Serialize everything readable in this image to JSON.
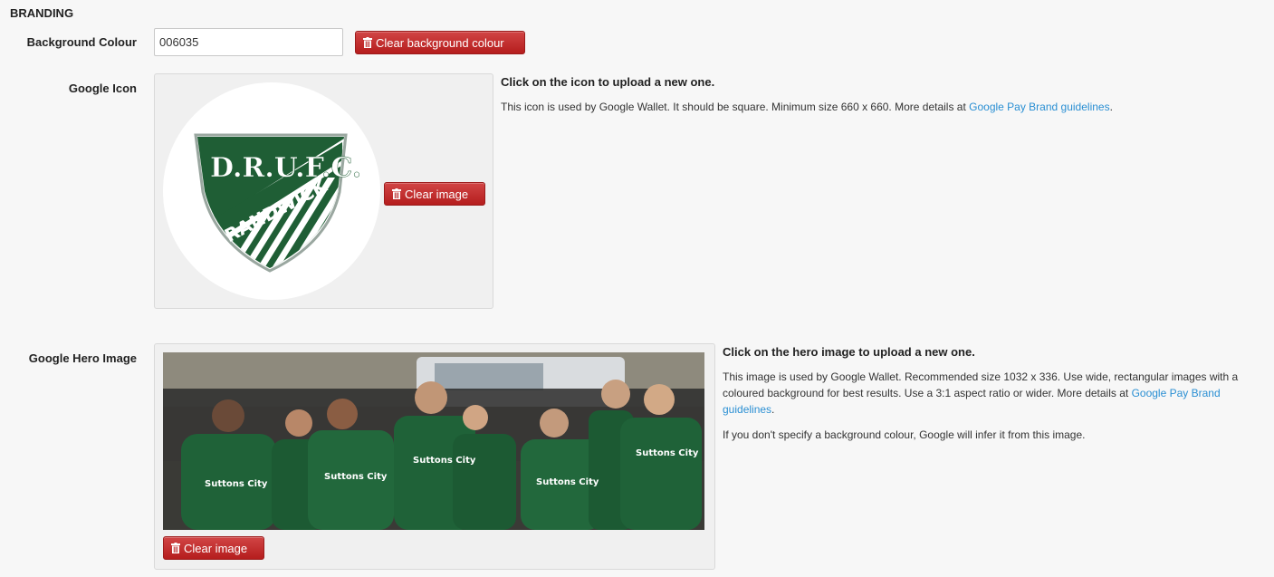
{
  "section": {
    "title": "BRANDING"
  },
  "background_colour": {
    "label": "Background Colour",
    "value": "006035",
    "clear_label": "Clear background colour"
  },
  "google_icon": {
    "label": "Google Icon",
    "help_title": "Click on the icon to upload a new one.",
    "help_text_prefix": "This icon is used by Google Wallet. It should be square. Minimum size 660 x 660. More details at ",
    "help_link": "Google Pay Brand guidelines",
    "help_text_suffix": ".",
    "clear_label": "Clear image",
    "logo_top_text": "D.R.U.F.C.",
    "logo_band_text": "RANDWICK"
  },
  "google_hero": {
    "label": "Google Hero Image",
    "help_title": "Click on the hero image to upload a new one.",
    "help_text_prefix": "This image is used by Google Wallet. Recommended size 1032 x 336. Use wide, rectangular images with a coloured background for best results. Use a 3:1 aspect ratio or wider. More details at ",
    "help_link": "Google Pay Brand guidelines",
    "help_text_suffix": ".",
    "help_note": "If you don't specify a background colour, Google will infer it from this image.",
    "clear_label": "Clear image",
    "jersey_text": "Suttons City"
  },
  "colors": {
    "brand_green": "#006035",
    "danger": "#c0282a",
    "link": "#2a8fd3"
  }
}
